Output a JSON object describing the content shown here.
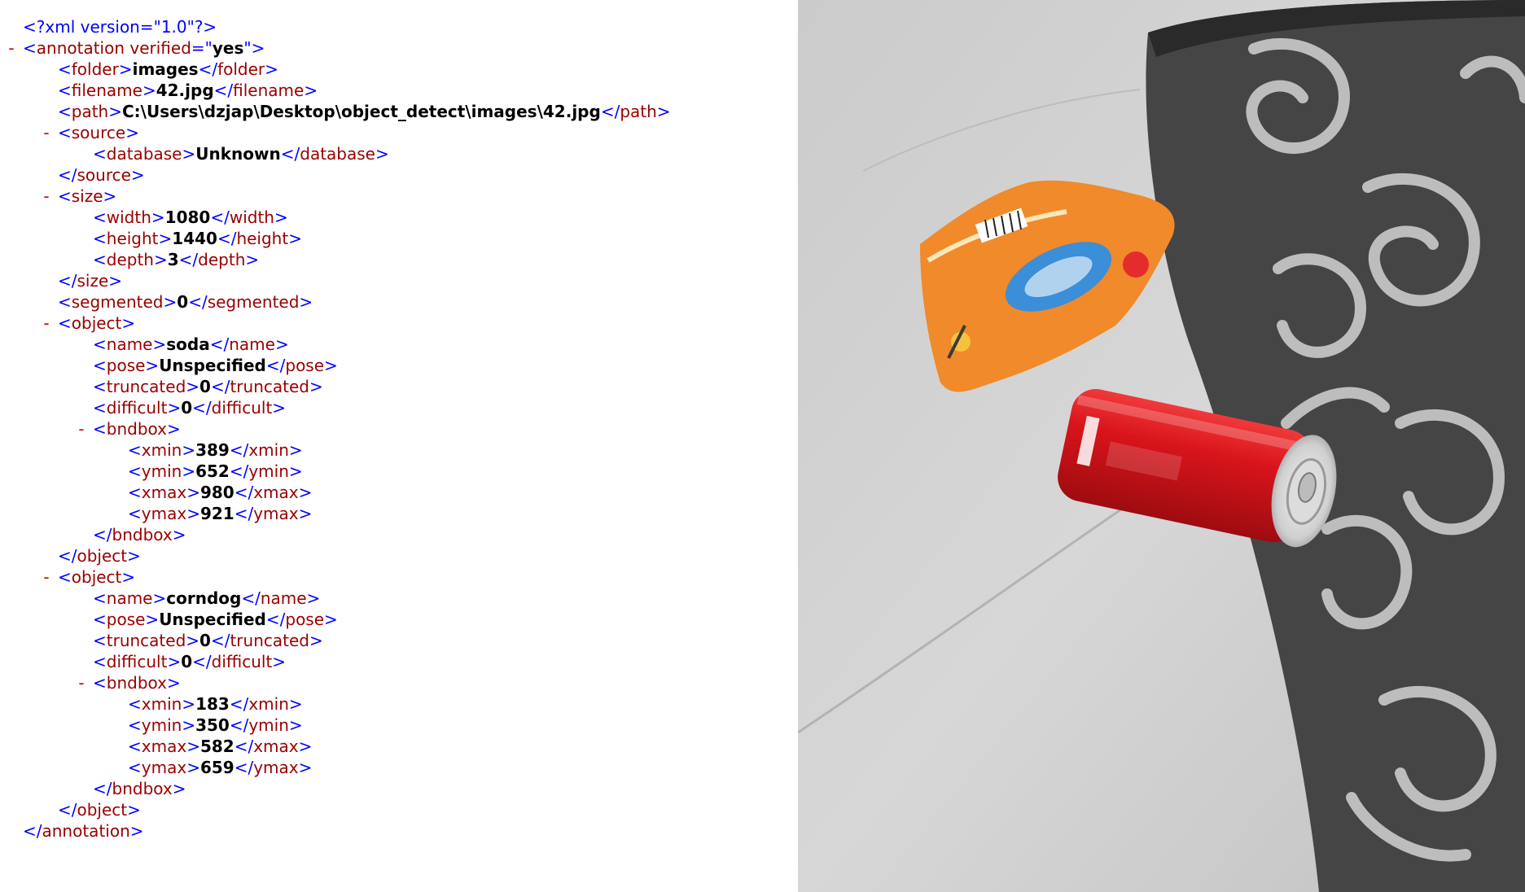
{
  "xml_lines": [
    {
      "depth": 0,
      "toggle": false,
      "parts": [
        [
          "pi",
          "<?xml version=\"1.0\"?>"
        ]
      ]
    },
    {
      "depth": 0,
      "toggle": true,
      "parts": [
        [
          "pun",
          "<"
        ],
        [
          "tag",
          "annotation"
        ],
        [
          "attr",
          " verified"
        ],
        [
          "pun",
          "=\""
        ],
        [
          "val",
          "yes"
        ],
        [
          "pun",
          "\">"
        ]
      ]
    },
    {
      "depth": 1,
      "toggle": false,
      "parts": [
        [
          "pun",
          "<"
        ],
        [
          "tag",
          "folder"
        ],
        [
          "pun",
          ">"
        ],
        [
          "txt",
          "images"
        ],
        [
          "pun",
          "</"
        ],
        [
          "tag",
          "folder"
        ],
        [
          "pun",
          ">"
        ]
      ]
    },
    {
      "depth": 1,
      "toggle": false,
      "parts": [
        [
          "pun",
          "<"
        ],
        [
          "tag",
          "filename"
        ],
        [
          "pun",
          ">"
        ],
        [
          "txt",
          "42.jpg"
        ],
        [
          "pun",
          "</"
        ],
        [
          "tag",
          "filename"
        ],
        [
          "pun",
          ">"
        ]
      ]
    },
    {
      "depth": 1,
      "toggle": false,
      "parts": [
        [
          "pun",
          "<"
        ],
        [
          "tag",
          "path"
        ],
        [
          "pun",
          ">"
        ],
        [
          "txt",
          "C:\\Users\\dzjap\\Desktop\\object_detect\\images\\42.jpg"
        ],
        [
          "pun",
          "</"
        ],
        [
          "tag",
          "path"
        ],
        [
          "pun",
          ">"
        ]
      ]
    },
    {
      "depth": 1,
      "toggle": true,
      "parts": [
        [
          "pun",
          "<"
        ],
        [
          "tag",
          "source"
        ],
        [
          "pun",
          ">"
        ]
      ]
    },
    {
      "depth": 2,
      "toggle": false,
      "parts": [
        [
          "pun",
          "<"
        ],
        [
          "tag",
          "database"
        ],
        [
          "pun",
          ">"
        ],
        [
          "txt",
          "Unknown"
        ],
        [
          "pun",
          "</"
        ],
        [
          "tag",
          "database"
        ],
        [
          "pun",
          ">"
        ]
      ]
    },
    {
      "depth": 1,
      "toggle": false,
      "parts": [
        [
          "pun",
          "</"
        ],
        [
          "tag",
          "source"
        ],
        [
          "pun",
          ">"
        ]
      ]
    },
    {
      "depth": 1,
      "toggle": true,
      "parts": [
        [
          "pun",
          "<"
        ],
        [
          "tag",
          "size"
        ],
        [
          "pun",
          ">"
        ]
      ]
    },
    {
      "depth": 2,
      "toggle": false,
      "parts": [
        [
          "pun",
          "<"
        ],
        [
          "tag",
          "width"
        ],
        [
          "pun",
          ">"
        ],
        [
          "txt",
          "1080"
        ],
        [
          "pun",
          "</"
        ],
        [
          "tag",
          "width"
        ],
        [
          "pun",
          ">"
        ]
      ]
    },
    {
      "depth": 2,
      "toggle": false,
      "parts": [
        [
          "pun",
          "<"
        ],
        [
          "tag",
          "height"
        ],
        [
          "pun",
          ">"
        ],
        [
          "txt",
          "1440"
        ],
        [
          "pun",
          "</"
        ],
        [
          "tag",
          "height"
        ],
        [
          "pun",
          ">"
        ]
      ]
    },
    {
      "depth": 2,
      "toggle": false,
      "parts": [
        [
          "pun",
          "<"
        ],
        [
          "tag",
          "depth"
        ],
        [
          "pun",
          ">"
        ],
        [
          "txt",
          "3"
        ],
        [
          "pun",
          "</"
        ],
        [
          "tag",
          "depth"
        ],
        [
          "pun",
          ">"
        ]
      ]
    },
    {
      "depth": 1,
      "toggle": false,
      "parts": [
        [
          "pun",
          "</"
        ],
        [
          "tag",
          "size"
        ],
        [
          "pun",
          ">"
        ]
      ]
    },
    {
      "depth": 1,
      "toggle": false,
      "parts": [
        [
          "pun",
          "<"
        ],
        [
          "tag",
          "segmented"
        ],
        [
          "pun",
          ">"
        ],
        [
          "txt",
          "0"
        ],
        [
          "pun",
          "</"
        ],
        [
          "tag",
          "segmented"
        ],
        [
          "pun",
          ">"
        ]
      ]
    },
    {
      "depth": 1,
      "toggle": true,
      "parts": [
        [
          "pun",
          "<"
        ],
        [
          "tag",
          "object"
        ],
        [
          "pun",
          ">"
        ]
      ]
    },
    {
      "depth": 2,
      "toggle": false,
      "parts": [
        [
          "pun",
          "<"
        ],
        [
          "tag",
          "name"
        ],
        [
          "pun",
          ">"
        ],
        [
          "txt",
          "soda"
        ],
        [
          "pun",
          "</"
        ],
        [
          "tag",
          "name"
        ],
        [
          "pun",
          ">"
        ]
      ]
    },
    {
      "depth": 2,
      "toggle": false,
      "parts": [
        [
          "pun",
          "<"
        ],
        [
          "tag",
          "pose"
        ],
        [
          "pun",
          ">"
        ],
        [
          "txt",
          "Unspecified"
        ],
        [
          "pun",
          "</"
        ],
        [
          "tag",
          "pose"
        ],
        [
          "pun",
          ">"
        ]
      ]
    },
    {
      "depth": 2,
      "toggle": false,
      "parts": [
        [
          "pun",
          "<"
        ],
        [
          "tag",
          "truncated"
        ],
        [
          "pun",
          ">"
        ],
        [
          "txt",
          "0"
        ],
        [
          "pun",
          "</"
        ],
        [
          "tag",
          "truncated"
        ],
        [
          "pun",
          ">"
        ]
      ]
    },
    {
      "depth": 2,
      "toggle": false,
      "parts": [
        [
          "pun",
          "<"
        ],
        [
          "tag",
          "difficult"
        ],
        [
          "pun",
          ">"
        ],
        [
          "txt",
          "0"
        ],
        [
          "pun",
          "</"
        ],
        [
          "tag",
          "difficult"
        ],
        [
          "pun",
          ">"
        ]
      ]
    },
    {
      "depth": 2,
      "toggle": true,
      "parts": [
        [
          "pun",
          "<"
        ],
        [
          "tag",
          "bndbox"
        ],
        [
          "pun",
          ">"
        ]
      ]
    },
    {
      "depth": 3,
      "toggle": false,
      "parts": [
        [
          "pun",
          "<"
        ],
        [
          "tag",
          "xmin"
        ],
        [
          "pun",
          ">"
        ],
        [
          "txt",
          "389"
        ],
        [
          "pun",
          "</"
        ],
        [
          "tag",
          "xmin"
        ],
        [
          "pun",
          ">"
        ]
      ]
    },
    {
      "depth": 3,
      "toggle": false,
      "parts": [
        [
          "pun",
          "<"
        ],
        [
          "tag",
          "ymin"
        ],
        [
          "pun",
          ">"
        ],
        [
          "txt",
          "652"
        ],
        [
          "pun",
          "</"
        ],
        [
          "tag",
          "ymin"
        ],
        [
          "pun",
          ">"
        ]
      ]
    },
    {
      "depth": 3,
      "toggle": false,
      "parts": [
        [
          "pun",
          "<"
        ],
        [
          "tag",
          "xmax"
        ],
        [
          "pun",
          ">"
        ],
        [
          "txt",
          "980"
        ],
        [
          "pun",
          "</"
        ],
        [
          "tag",
          "xmax"
        ],
        [
          "pun",
          ">"
        ]
      ]
    },
    {
      "depth": 3,
      "toggle": false,
      "parts": [
        [
          "pun",
          "<"
        ],
        [
          "tag",
          "ymax"
        ],
        [
          "pun",
          ">"
        ],
        [
          "txt",
          "921"
        ],
        [
          "pun",
          "</"
        ],
        [
          "tag",
          "ymax"
        ],
        [
          "pun",
          ">"
        ]
      ]
    },
    {
      "depth": 2,
      "toggle": false,
      "parts": [
        [
          "pun",
          "</"
        ],
        [
          "tag",
          "bndbox"
        ],
        [
          "pun",
          ">"
        ]
      ]
    },
    {
      "depth": 1,
      "toggle": false,
      "parts": [
        [
          "pun",
          "</"
        ],
        [
          "tag",
          "object"
        ],
        [
          "pun",
          ">"
        ]
      ]
    },
    {
      "depth": 1,
      "toggle": true,
      "parts": [
        [
          "pun",
          "<"
        ],
        [
          "tag",
          "object"
        ],
        [
          "pun",
          ">"
        ]
      ]
    },
    {
      "depth": 2,
      "toggle": false,
      "parts": [
        [
          "pun",
          "<"
        ],
        [
          "tag",
          "name"
        ],
        [
          "pun",
          ">"
        ],
        [
          "txt",
          "corndog"
        ],
        [
          "pun",
          "</"
        ],
        [
          "tag",
          "name"
        ],
        [
          "pun",
          ">"
        ]
      ]
    },
    {
      "depth": 2,
      "toggle": false,
      "parts": [
        [
          "pun",
          "<"
        ],
        [
          "tag",
          "pose"
        ],
        [
          "pun",
          ">"
        ],
        [
          "txt",
          "Unspecified"
        ],
        [
          "pun",
          "</"
        ],
        [
          "tag",
          "pose"
        ],
        [
          "pun",
          ">"
        ]
      ]
    },
    {
      "depth": 2,
      "toggle": false,
      "parts": [
        [
          "pun",
          "<"
        ],
        [
          "tag",
          "truncated"
        ],
        [
          "pun",
          ">"
        ],
        [
          "txt",
          "0"
        ],
        [
          "pun",
          "</"
        ],
        [
          "tag",
          "truncated"
        ],
        [
          "pun",
          ">"
        ]
      ]
    },
    {
      "depth": 2,
      "toggle": false,
      "parts": [
        [
          "pun",
          "<"
        ],
        [
          "tag",
          "difficult"
        ],
        [
          "pun",
          ">"
        ],
        [
          "txt",
          "0"
        ],
        [
          "pun",
          "</"
        ],
        [
          "tag",
          "difficult"
        ],
        [
          "pun",
          ">"
        ]
      ]
    },
    {
      "depth": 2,
      "toggle": true,
      "parts": [
        [
          "pun",
          "<"
        ],
        [
          "tag",
          "bndbox"
        ],
        [
          "pun",
          ">"
        ]
      ]
    },
    {
      "depth": 3,
      "toggle": false,
      "parts": [
        [
          "pun",
          "<"
        ],
        [
          "tag",
          "xmin"
        ],
        [
          "pun",
          ">"
        ],
        [
          "txt",
          "183"
        ],
        [
          "pun",
          "</"
        ],
        [
          "tag",
          "xmin"
        ],
        [
          "pun",
          ">"
        ]
      ]
    },
    {
      "depth": 3,
      "toggle": false,
      "parts": [
        [
          "pun",
          "<"
        ],
        [
          "tag",
          "ymin"
        ],
        [
          "pun",
          ">"
        ],
        [
          "txt",
          "350"
        ],
        [
          "pun",
          "</"
        ],
        [
          "tag",
          "ymin"
        ],
        [
          "pun",
          ">"
        ]
      ]
    },
    {
      "depth": 3,
      "toggle": false,
      "parts": [
        [
          "pun",
          "<"
        ],
        [
          "tag",
          "xmax"
        ],
        [
          "pun",
          ">"
        ],
        [
          "txt",
          "582"
        ],
        [
          "pun",
          "</"
        ],
        [
          "tag",
          "xmax"
        ],
        [
          "pun",
          ">"
        ]
      ]
    },
    {
      "depth": 3,
      "toggle": false,
      "parts": [
        [
          "pun",
          "<"
        ],
        [
          "tag",
          "ymax"
        ],
        [
          "pun",
          ">"
        ],
        [
          "txt",
          "659"
        ],
        [
          "pun",
          "</"
        ],
        [
          "tag",
          "ymax"
        ],
        [
          "pun",
          ">"
        ]
      ]
    },
    {
      "depth": 2,
      "toggle": false,
      "parts": [
        [
          "pun",
          "</"
        ],
        [
          "tag",
          "bndbox"
        ],
        [
          "pun",
          ">"
        ]
      ]
    },
    {
      "depth": 1,
      "toggle": false,
      "parts": [
        [
          "pun",
          "</"
        ],
        [
          "tag",
          "object"
        ],
        [
          "pun",
          ">"
        ]
      ]
    },
    {
      "depth": 0,
      "toggle": false,
      "parts": [
        [
          "pun",
          "</"
        ],
        [
          "tag",
          "annotation"
        ],
        [
          "pun",
          ">"
        ]
      ]
    }
  ],
  "toggle_symbol": "-",
  "photo": {
    "objects": [
      "soda-can",
      "corndog-wrapper"
    ],
    "colors": {
      "sofa": "#d2d2d2",
      "pillow_dark": "#3a3a3a",
      "pillow_light": "#b8b8b8",
      "can_red": "#d8141b",
      "wrapper_orange": "#f08a2a"
    }
  }
}
